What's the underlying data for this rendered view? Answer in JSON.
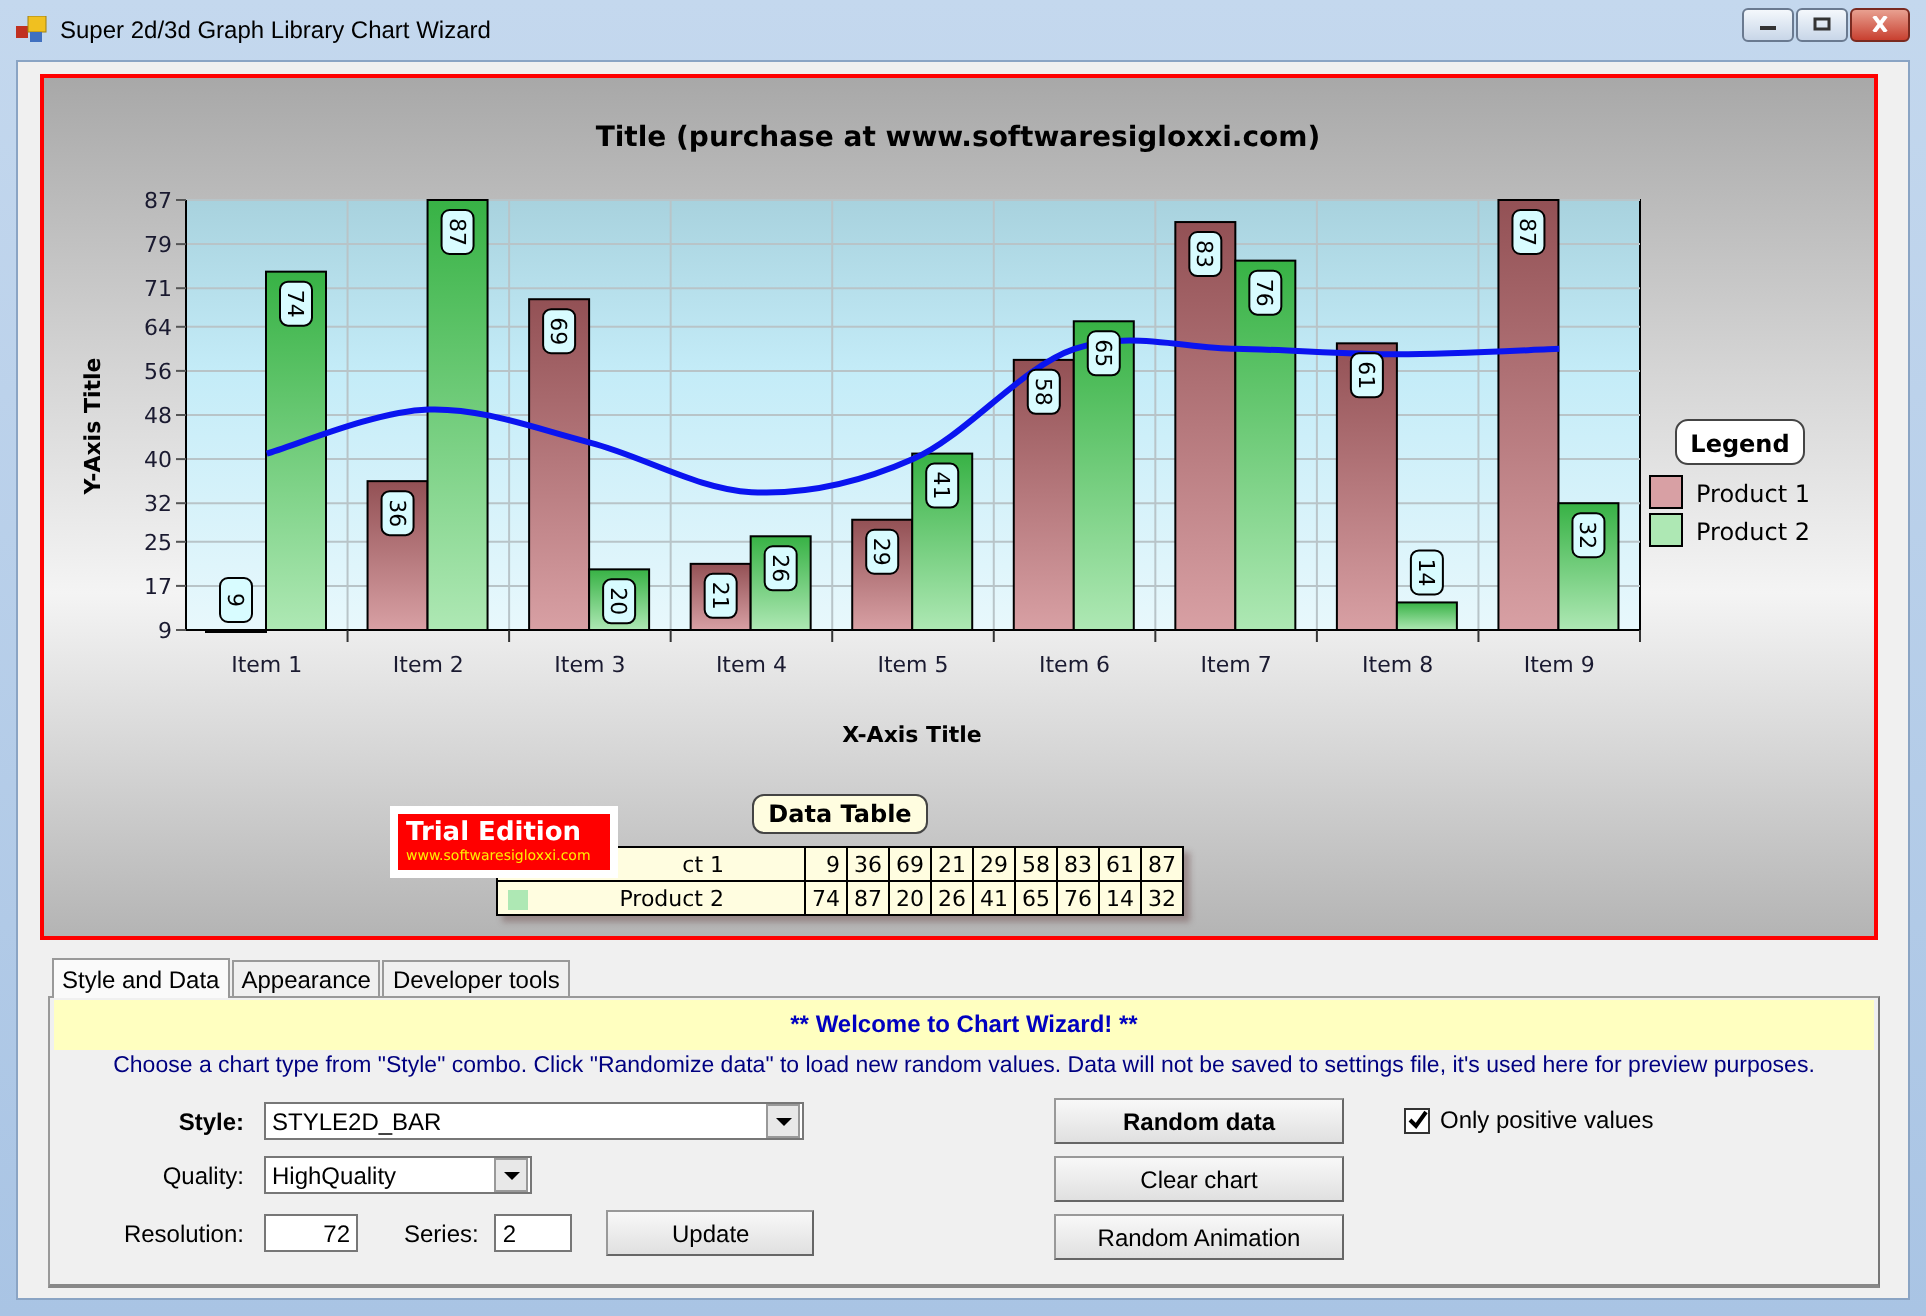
{
  "window": {
    "title": "Super 2d/3d Graph Library Chart Wizard"
  },
  "chart": {
    "legend_title": "Legend",
    "chart_data": {
      "type": "bar",
      "title": "Title (purchase at www.softwaresigloxxi.com)",
      "xlabel": "X-Axis Title",
      "ylabel": "Y-Axis Title",
      "categories": [
        "Item 1",
        "Item 2",
        "Item 3",
        "Item 4",
        "Item 5",
        "Item 6",
        "Item 7",
        "Item 8",
        "Item 9"
      ],
      "series": [
        {
          "name": "Product 1",
          "color": "#d8a0a4",
          "values": [
            9,
            36,
            69,
            21,
            29,
            58,
            83,
            61,
            87
          ]
        },
        {
          "name": "Product 2",
          "color": "#aee8b4",
          "values": [
            74,
            87,
            20,
            26,
            41,
            65,
            76,
            14,
            32
          ]
        },
        {
          "type": "line",
          "color": "#0a14f0",
          "values": [
            41,
            49,
            43,
            34,
            40,
            60,
            60,
            59,
            60
          ]
        }
      ],
      "ylim": [
        9,
        87
      ],
      "yticks": [
        9,
        17,
        25,
        32,
        40,
        48,
        56,
        64,
        71,
        79,
        87
      ],
      "value_labels": [
        [
          "9",
          "36",
          "69",
          "21",
          "29",
          "58",
          "83",
          "61",
          "87"
        ],
        [
          "74",
          "87",
          "20",
          "26",
          "41",
          "65",
          "76",
          "14",
          "32"
        ],
        [
          null,
          null,
          null,
          null,
          null,
          null,
          null,
          null,
          null
        ]
      ],
      "grid": true,
      "legend": true
    },
    "data_table": {
      "title": "Data Table",
      "rows": [
        {
          "label": "ct 1",
          "values": [
            "9",
            "36",
            "69",
            "21",
            "29",
            "58",
            "83",
            "61",
            "87"
          ]
        },
        {
          "label": "Product 2",
          "color": "#aee8b4",
          "values": [
            "74",
            "87",
            "20",
            "26",
            "41",
            "65",
            "76",
            "14",
            "32"
          ]
        }
      ]
    },
    "trial_badge": {
      "title": "Trial Edition",
      "url": "www.softwaresigloxxi.com"
    }
  },
  "tabs": [
    {
      "label": "Style and Data",
      "selected": true
    },
    {
      "label": "Appearance",
      "selected": false
    },
    {
      "label": "Developer tools",
      "selected": false
    }
  ],
  "banner": "** Welcome to Chart Wizard! **",
  "description": "Choose a chart type from \"Style\" combo. Click \"Randomize data\" to load new random values. Data will not be saved to settings file, it's used here for preview purposes.",
  "style": {
    "label": "Style:",
    "value": "STYLE2D_BAR"
  },
  "quality": {
    "label": "Quality:",
    "value": "HighQuality"
  },
  "resolution": {
    "label": "Resolution:",
    "value": "72"
  },
  "series": {
    "label": "Series:",
    "value": "2"
  },
  "update_button": "Update",
  "buttons": [
    {
      "label": "Random data",
      "bold": true
    },
    {
      "label": "Clear chart",
      "bold": false
    },
    {
      "label": "Random Animation",
      "bold": false
    }
  ],
  "checkbox": {
    "label": "Only positive values",
    "checked": true
  }
}
